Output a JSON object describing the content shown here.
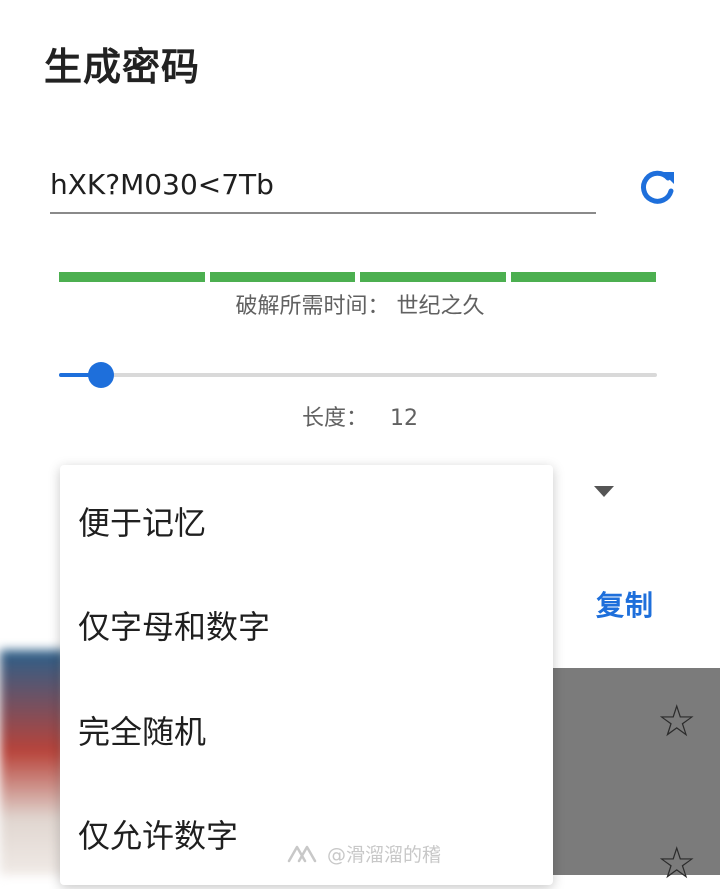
{
  "header": {
    "title": "生成密码"
  },
  "password": {
    "value": "hXK?M030<7Tb"
  },
  "strength": {
    "segments": 4,
    "filled": 4,
    "color": "#4caf50",
    "label": "破解所需时间：  世纪之久"
  },
  "length": {
    "label": "长度：",
    "value": "12",
    "fraction": 0.07
  },
  "mode_menu": {
    "items": [
      "便于记忆",
      "仅字母和数字",
      "完全随机",
      "仅允许数字"
    ]
  },
  "actions": {
    "copy_label": "复制"
  },
  "background": {
    "star_icon": "star-outline-icon"
  },
  "watermark": {
    "text": "@滑溜溜的稽"
  },
  "colors": {
    "accent": "#1e6fdb",
    "strength": "#4caf50",
    "text": "#1f1f1f",
    "muted": "#616161"
  }
}
